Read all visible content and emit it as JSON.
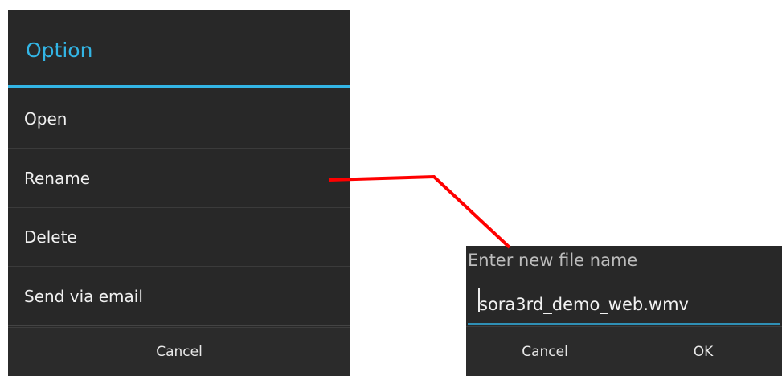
{
  "option_dialog": {
    "title": "Option",
    "items": [
      {
        "label": "Open"
      },
      {
        "label": "Rename"
      },
      {
        "label": "Delete"
      },
      {
        "label": "Send via email"
      }
    ],
    "cancel_label": "Cancel"
  },
  "rename_dialog": {
    "title": "Enter new file name",
    "filename_value": "sora3rd_demo_web.wmv",
    "cancel_label": "Cancel",
    "ok_label": "OK"
  },
  "colors": {
    "accent": "#33b5e5",
    "dialog_bg": "#282828",
    "connector": "#ff0000"
  }
}
